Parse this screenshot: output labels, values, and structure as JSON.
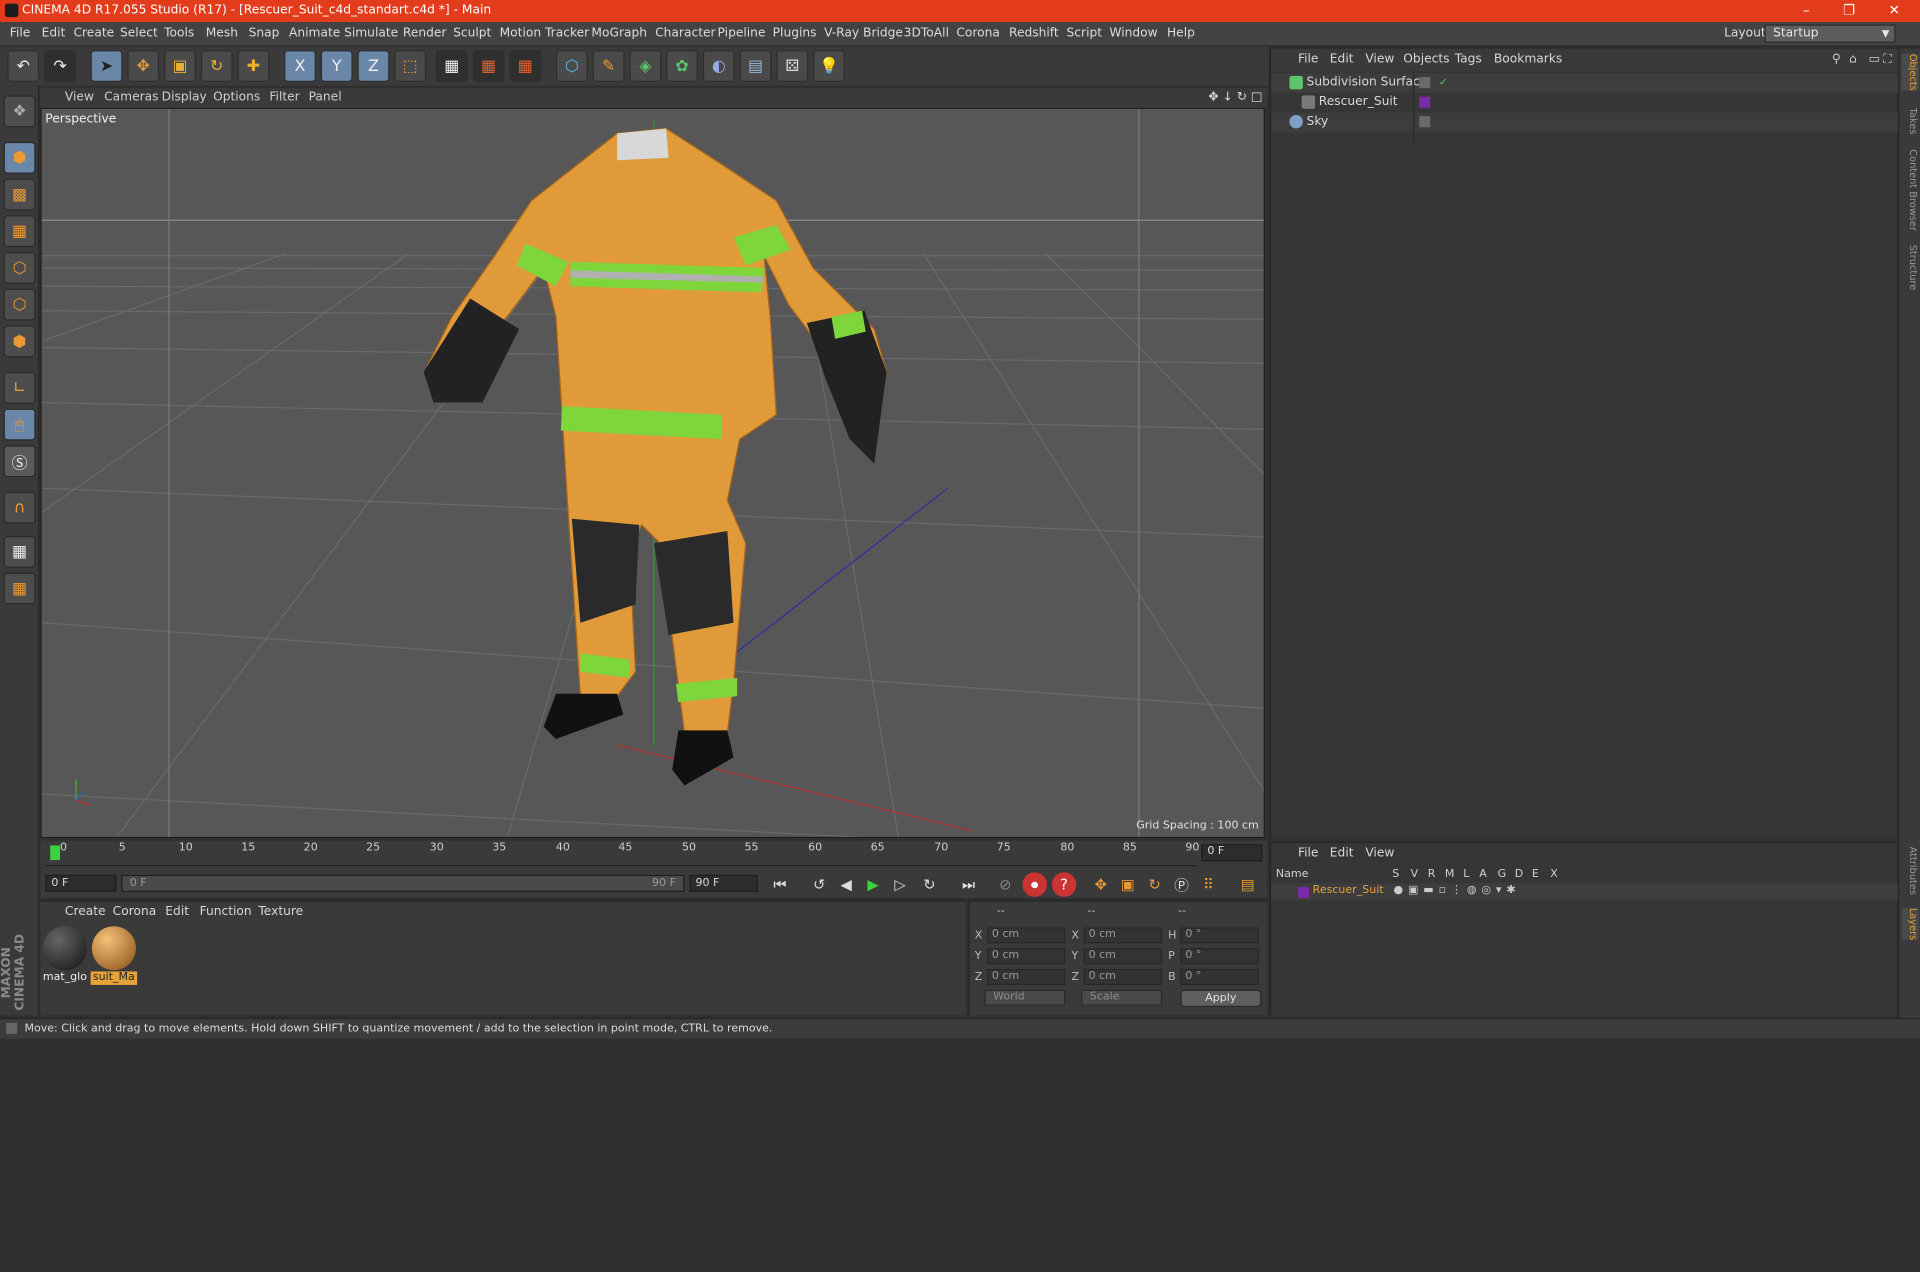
{
  "window": {
    "title": "CINEMA 4D R17.055 Studio (R17) - [Rescuer_Suit_c4d_standart.c4d *] - Main",
    "controls": [
      "–",
      "❐",
      "✕"
    ]
  },
  "menubar": {
    "items": [
      "File",
      "Edit",
      "Create",
      "Select",
      "Tools",
      "Mesh",
      "Snap",
      "Animate",
      "Simulate",
      "Render",
      "Sculpt",
      "Motion Tracker",
      "MoGraph",
      "Character",
      "Pipeline",
      "Plugins",
      "V-Ray Bridge",
      "3DToAll",
      "Corona",
      "Redshift",
      "Script",
      "Window",
      "Help"
    ],
    "layout_label": "Layout:",
    "layout_value": "Startup"
  },
  "toolbar": {
    "axis_labels": [
      "X",
      "Y",
      "Z"
    ]
  },
  "viewport": {
    "menu": [
      "View",
      "Cameras",
      "Display",
      "Options",
      "Filter",
      "Panel"
    ],
    "camera_label": "Perspective",
    "grid_spacing": "Grid Spacing : 100 cm",
    "nav_icons": "✥ ↓ ↻ □"
  },
  "timeline": {
    "ticks": [
      "0",
      "5",
      "10",
      "15",
      "20",
      "25",
      "30",
      "35",
      "40",
      "45",
      "50",
      "55",
      "60",
      "65",
      "70",
      "75",
      "80",
      "85",
      "90"
    ],
    "current_frame": "0 F",
    "start_field": "0 F",
    "range_start": "0 F",
    "range_end": "90 F",
    "end_field": "90 F"
  },
  "materials": {
    "menu": [
      "Create",
      "Corona",
      "Edit",
      "Function",
      "Texture"
    ],
    "items": [
      {
        "label": "mat_glo",
        "color": "#2b2b2b"
      },
      {
        "label": "suit_Ma",
        "color": "#c8862c"
      }
    ]
  },
  "coordinates": {
    "headers": [
      "--",
      "--",
      "--"
    ],
    "rows": [
      {
        "a": "X",
        "av": "0 cm",
        "b": "X",
        "bv": "0 cm",
        "c": "H",
        "cv": "0 °"
      },
      {
        "a": "Y",
        "av": "0 cm",
        "b": "Y",
        "bv": "0 cm",
        "c": "P",
        "cv": "0 °"
      },
      {
        "a": "Z",
        "av": "0 cm",
        "b": "Z",
        "bv": "0 cm",
        "c": "B",
        "cv": "0 °"
      }
    ],
    "mode": "World",
    "transform": "Scale",
    "apply": "Apply"
  },
  "object_manager": {
    "menu": [
      "File",
      "Edit",
      "View",
      "Objects",
      "Tags",
      "Bookmarks"
    ],
    "objects": [
      {
        "name": "Subdivision Surface",
        "icon_color": "#5cc46a"
      },
      {
        "name": "Rescuer_Suit",
        "icon_color": "#7a7a7a"
      },
      {
        "name": "Sky",
        "icon_color": "#7f9fc9"
      }
    ]
  },
  "layer_manager": {
    "menu": [
      "File",
      "Edit",
      "View"
    ],
    "columns": [
      "Name",
      "S",
      "V",
      "R",
      "M",
      "L",
      "A",
      "G",
      "D",
      "E",
      "X"
    ],
    "layers": [
      {
        "name": "Rescuer_Suit",
        "color": "#7a2aa8"
      }
    ]
  },
  "side_tabs": [
    "Objects",
    "Takes",
    "Content Browser",
    "Structure",
    "Attributes",
    "Layers"
  ],
  "status": {
    "text": "Move: Click and drag to move elements. Hold down SHIFT to quantize movement / add to the selection in point mode, CTRL to remove."
  },
  "branding": {
    "logo_text": "MAXON CINEMA 4D"
  },
  "colors": {
    "titlebar": "#e33c1c",
    "accent": "#e7a23a",
    "suit": "#e09a3a",
    "reflective": "#7fd63a"
  }
}
